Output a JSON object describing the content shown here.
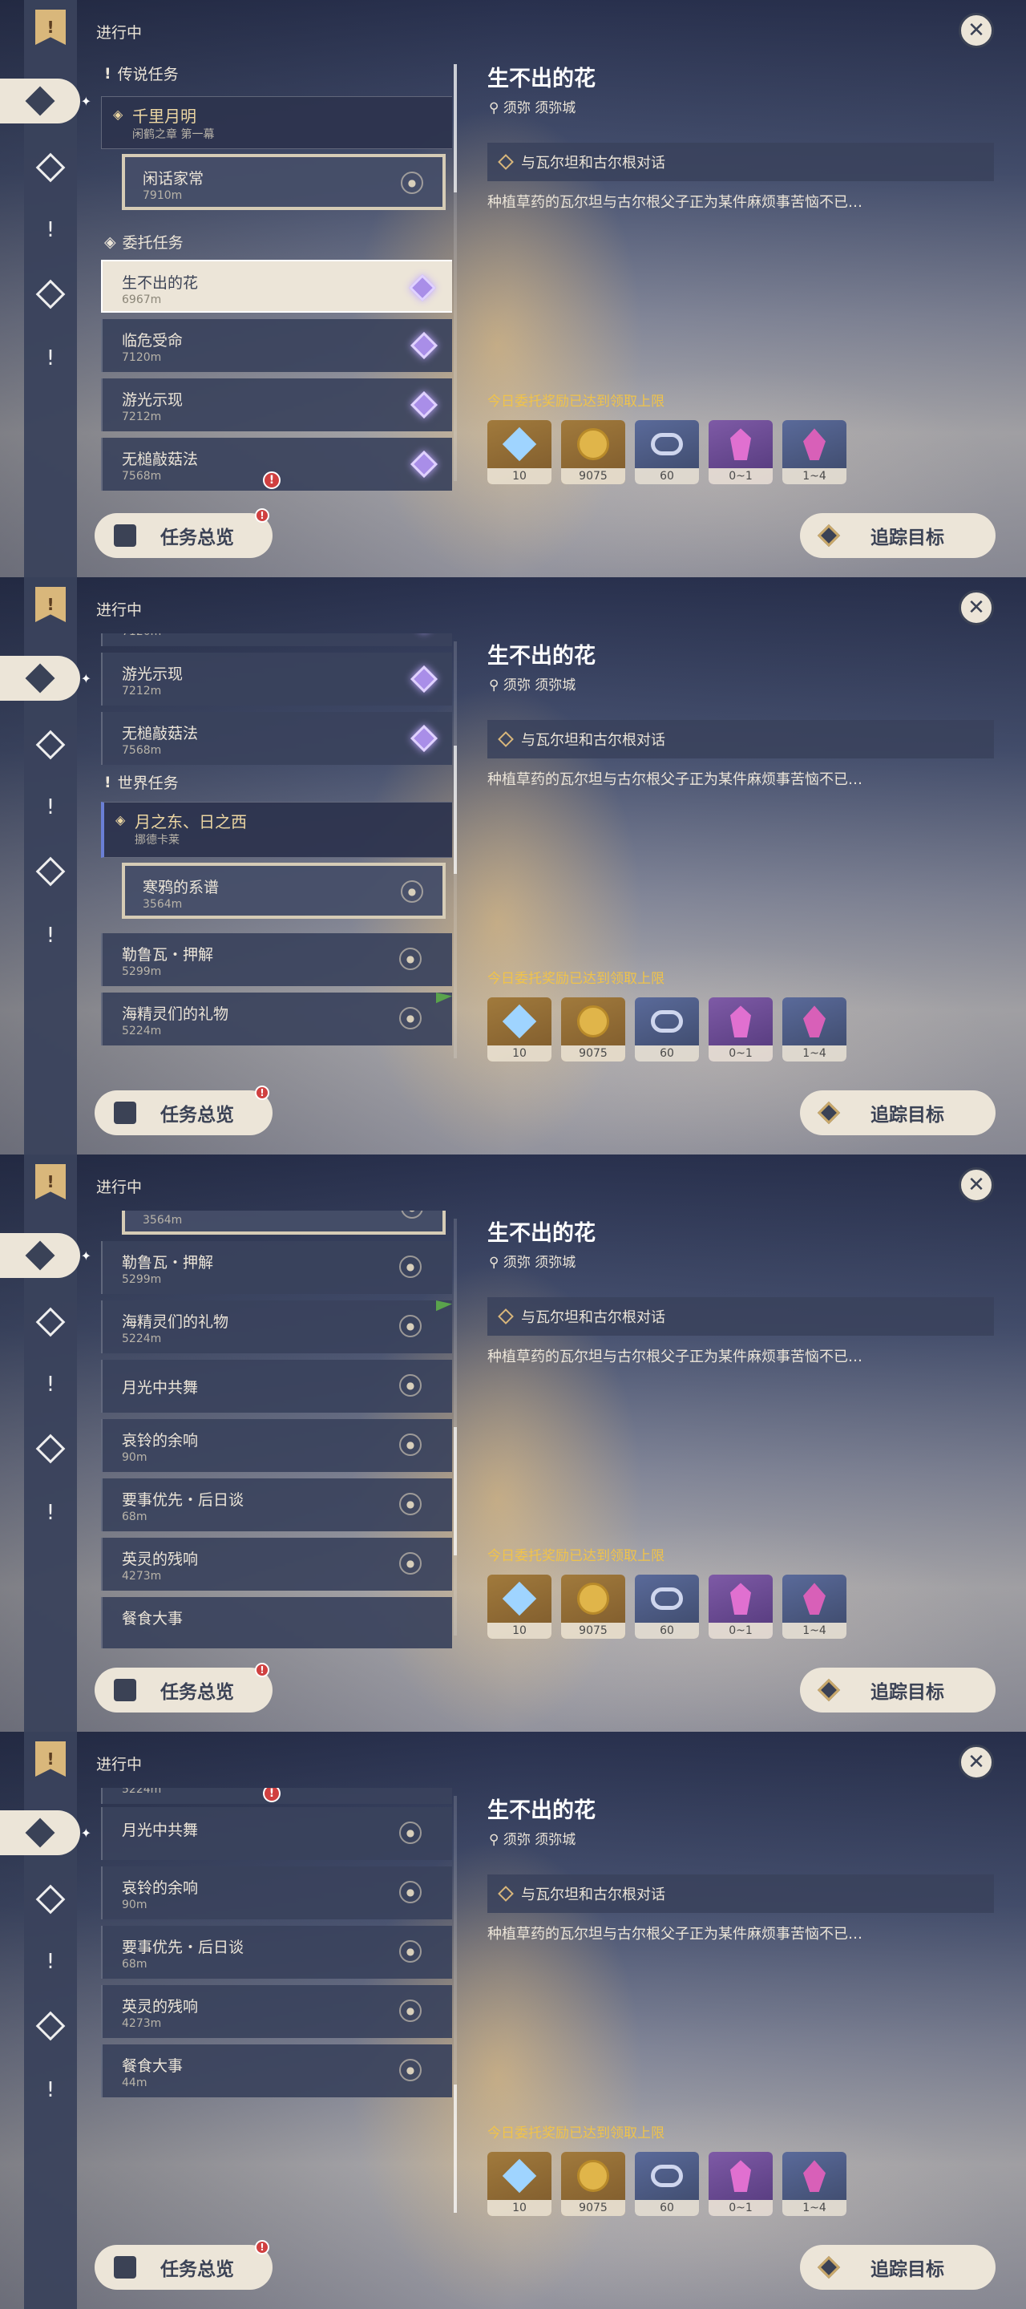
{
  "header": {
    "status": "进行中"
  },
  "nav": {
    "top_icon": "!"
  },
  "sections": {
    "legend": "传说任务",
    "commission": "委托任务",
    "world": "世界任务"
  },
  "quests": {
    "legend_main": {
      "name": "千里月明",
      "chapter": "闲鹤之章 第一幕"
    },
    "legend_sub": {
      "name": "闲话家常",
      "dist": "7910m"
    },
    "c1": {
      "name": "生不出的花",
      "dist": "6967m"
    },
    "c2": {
      "name": "临危受命",
      "dist": "7120m"
    },
    "c3": {
      "name": "游光示现",
      "dist": "7212m"
    },
    "c4": {
      "name": "无槌敲菇法",
      "dist": "7568m"
    },
    "world_main": {
      "name": "月之东、日之西",
      "chapter": "挪德卡莱"
    },
    "world_sub": {
      "name": "寒鸦的系谱",
      "dist": "3564m"
    },
    "w1": {
      "name": "勒鲁瓦・押解",
      "dist": "5299m"
    },
    "w2": {
      "name": "海精灵们的礼物",
      "dist": "5224m"
    },
    "w3": {
      "name": "月光中共舞",
      "dist": ""
    },
    "w4": {
      "name": "哀铃的余响",
      "dist": "90m"
    },
    "w5": {
      "name": "要事优先・后日谈",
      "dist": "68m"
    },
    "w6": {
      "name": "英灵的残响",
      "dist": "4273m"
    },
    "w7": {
      "name": "餐食大事",
      "dist": "44m"
    }
  },
  "detail": {
    "title": "生不出的花",
    "location": "须弥 须弥城",
    "objective": "与瓦尔坦和古尔根对话",
    "description": "种植草药的瓦尔坦与古尔根父子正为某件麻烦事苦恼不已…",
    "reward_note": "今日委托奖励已达到领取上限",
    "rewards": [
      {
        "count": "10",
        "icon": "primogem-icon"
      },
      {
        "count": "9075",
        "icon": "mora-icon"
      },
      {
        "count": "60",
        "icon": "companionship-exp-icon"
      },
      {
        "count": "0~1",
        "icon": "crystal-purple-icon"
      },
      {
        "count": "1~4",
        "icon": "crystal-pink-icon"
      }
    ]
  },
  "buttons": {
    "overview": "任务总览",
    "track": "追踪目标",
    "close": "✕",
    "alert": "!"
  },
  "colors": {
    "accent": "#ece5d8",
    "reward_note": "#f0c34a",
    "panel": "#3a425c"
  }
}
